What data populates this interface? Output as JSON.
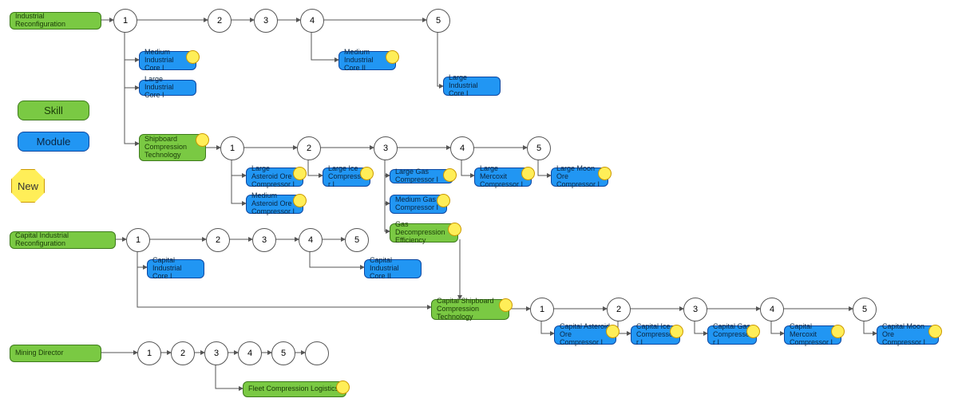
{
  "legend": {
    "skill": "Skill",
    "module": "Module",
    "new": "New"
  },
  "roots": {
    "ind": "Industrial Reconfiguration",
    "cap": "Capital Industrial Reconfiguration",
    "mining": "Mining Director"
  },
  "skills": {
    "shipcomp": "Shipboard Compression Technology",
    "gasdecomp": "Gas Decompression Efficiency",
    "capship": "Capital Shipboard Compression Technology",
    "fleet": "Fleet Compression Logistics"
  },
  "modules": {
    "mic1": "Medium Industrial Core I",
    "lic1": "Large Industrial Core I",
    "mic2": "Medium Industrial Core II",
    "licI": "Large Industrial Core I",
    "laoc": "Large Asteroid Ore Compressor I",
    "maoc": "Medium Asteroid Ore Compressor  I",
    "lice": "Large Ice Compressor I",
    "lgas": "Large Gas Compressor I",
    "mgas": "Medium Gas Compressor I",
    "lmerc": "Large Mercoxit Compressor  I",
    "lmoon": "Large Moon Ore Compressor I",
    "cic1": "Capital Industrial Core I",
    "cic2": "Capital Industrial Core II",
    "caoc": "Capital Asteroid Ore Compressor  I",
    "cice": "Capital Ice Compressor I",
    "cgas": "Capital Gas Compressor  I",
    "cmerc": "Capital Mercoxit Compressor  I",
    "cmoon": "Capital Moon Ore Compressor  I"
  },
  "lv": {
    "1": "1",
    "2": "2",
    "3": "3",
    "4": "4",
    "5": "5"
  }
}
